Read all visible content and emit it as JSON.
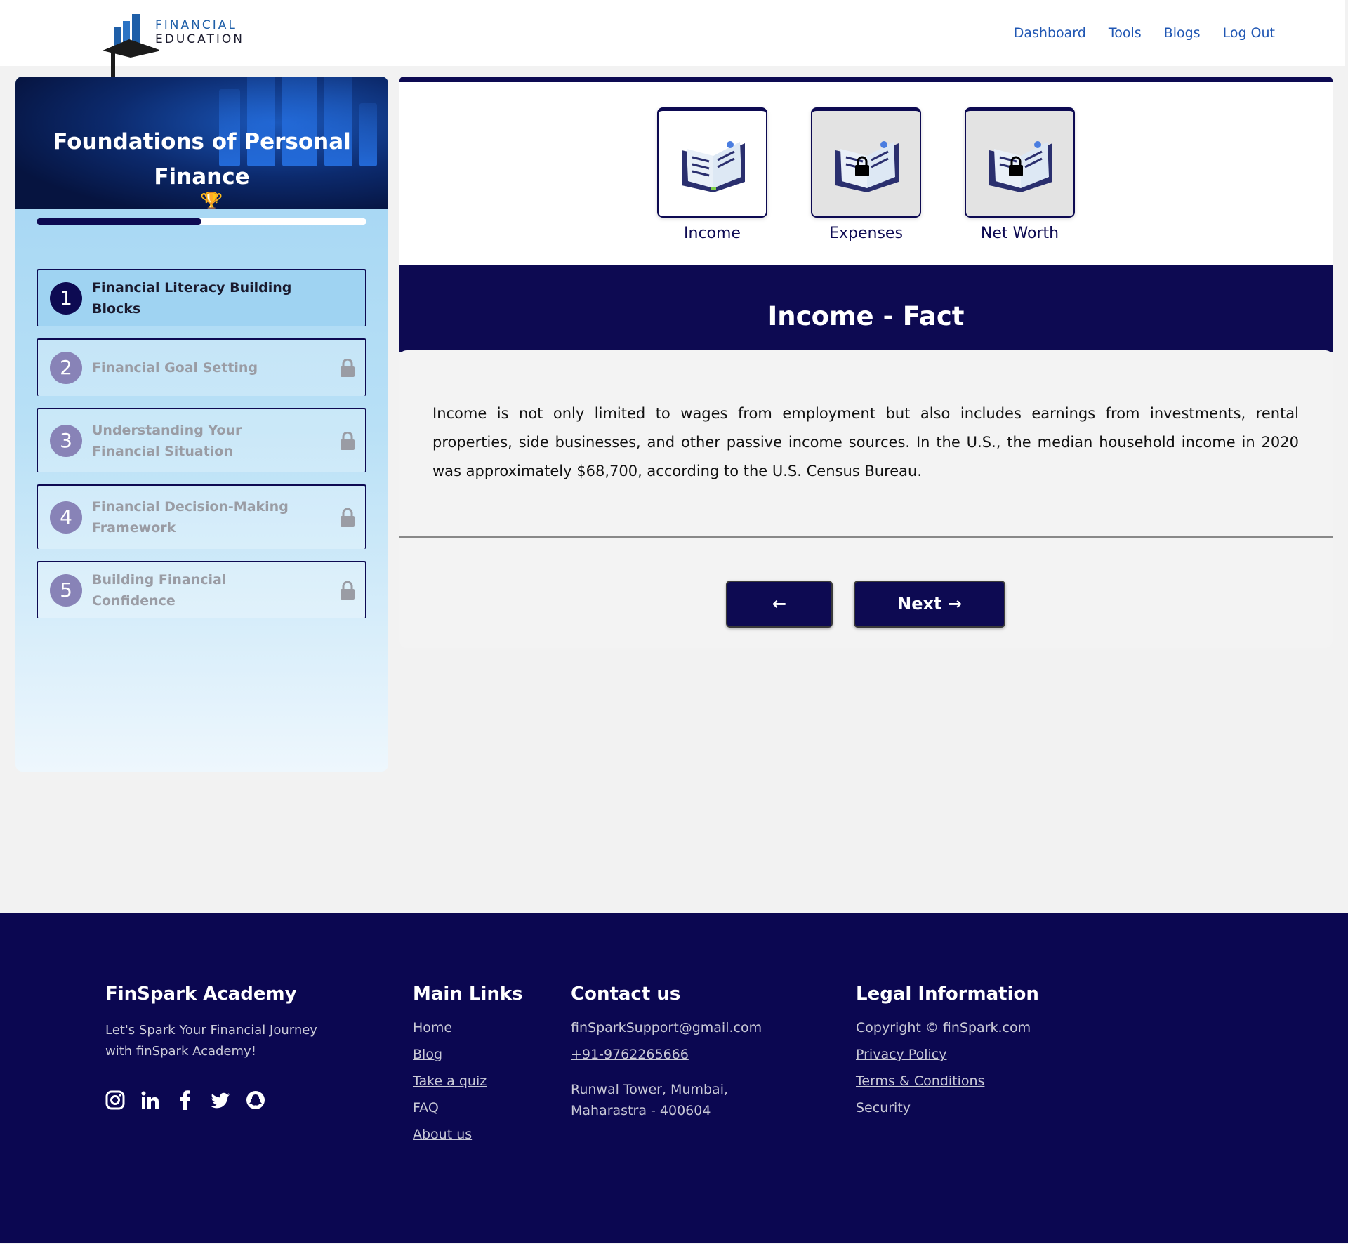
{
  "header": {
    "logo_line1": "FINANCIAL",
    "logo_line2": "EDUCATION",
    "nav": [
      "Dashboard",
      "Tools",
      "Blogs",
      "Log Out"
    ]
  },
  "sidebar": {
    "course_title": "Foundations of Personal Finance",
    "progress": 0.5,
    "modules": [
      {
        "num": "1",
        "title": "Financial Literacy Building Blocks",
        "locked": false,
        "active": true
      },
      {
        "num": "2",
        "title": "Financial Goal Setting",
        "locked": true,
        "active": false
      },
      {
        "num": "3",
        "title": "Understanding Your Financial Situation",
        "locked": true,
        "active": false
      },
      {
        "num": "4",
        "title": "Financial Decision-Making Framework",
        "locked": true,
        "active": false
      },
      {
        "num": "5",
        "title": "Building Financial Confidence",
        "locked": true,
        "active": false
      }
    ]
  },
  "topics": [
    {
      "label": "Income",
      "locked": false
    },
    {
      "label": "Expenses",
      "locked": true
    },
    {
      "label": "Net Worth",
      "locked": true
    }
  ],
  "fact": {
    "title": "Income - Fact",
    "text": "Income is not only limited to wages from employment but also includes earnings from investments, rental properties, side businesses, and other passive income sources. In the U.S., the median household income in 2020 was approximately $68,700, according to the U.S. Census Bureau.",
    "prev_label": "←",
    "next_label": "Next →"
  },
  "footer": {
    "brand": "FinSpark Academy",
    "tagline": "Let's Spark Your Financial Journey with finSpark Academy!",
    "social_icons": [
      "instagram-icon",
      "linkedin-icon",
      "facebook-icon",
      "twitter-icon",
      "snapchat-icon"
    ],
    "main_links_heading": "Main Links",
    "main_links": [
      "Home",
      "Blog",
      "Take a quiz",
      "FAQ",
      "About us"
    ],
    "contact_heading": "Contact us",
    "email": "finSparkSupport@gmail.com",
    "phone": "+91-9762265666",
    "address_line1": "Runwal Tower, Mumbai,",
    "address_line2": "Maharastra - 400604",
    "legal_heading": "Legal Information",
    "legal_links": [
      "Copyright © finSpark.com",
      "Privacy Policy",
      "Terms & Conditions",
      "Security"
    ]
  },
  "colors": {
    "navy": "#0d0a52",
    "footer_bg": "#0b0751",
    "nav_link": "#1f56b3",
    "sidebar_light": "#9fd3f2"
  }
}
